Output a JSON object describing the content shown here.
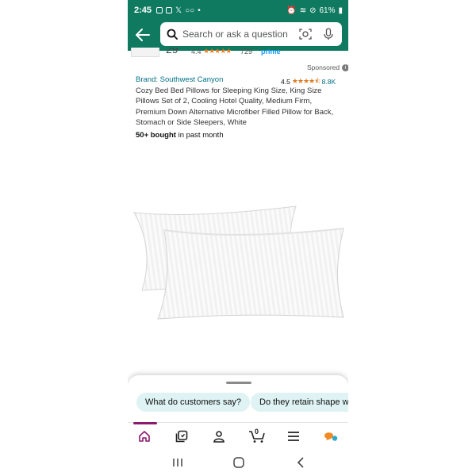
{
  "status_bar": {
    "time": "2:45",
    "battery": "61%"
  },
  "search": {
    "placeholder": "Search or ask a question"
  },
  "previous_item": {
    "count_partial": "29",
    "rating": "4.4",
    "reviews": "729",
    "prime": "prime"
  },
  "product": {
    "sponsored": "Sponsored",
    "brand": "Brand: Southwest Canyon",
    "rating": "4.5",
    "review_count": "8.8K",
    "title": "Cozy Bed Bed Pillows for Sleeping King Size, King Size Pillows Set of 2, Cooling Hotel Quality, Medium Firm, Premium Down Alternative Microfiber Filled Pillow for Back, Stomach or Side Sleepers, White",
    "bought_bold": "50+ bought",
    "bought_rest": " in past month"
  },
  "suggestions": [
    "What do customers say?",
    "Do they retain shape w"
  ],
  "bottom_nav": {
    "cart_count": "0",
    "items": [
      "home-icon",
      "library-icon",
      "account-icon",
      "cart-icon",
      "menu-icon",
      "rufus-icon"
    ]
  },
  "colors": {
    "header": "#0f7a60",
    "link": "#007185",
    "star": "#de7921",
    "chip": "#dff2f4",
    "nav_accent": "#8b1a6e"
  }
}
